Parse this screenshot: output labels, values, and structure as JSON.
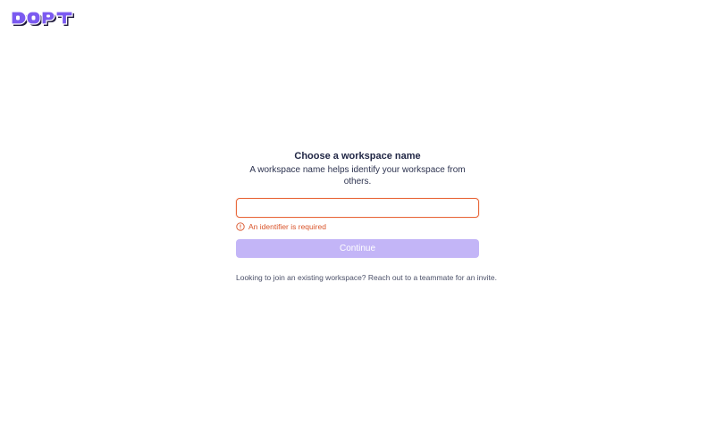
{
  "logo": {
    "text": "DOPT",
    "brand_color": "#7b5af0",
    "shadow_color": "#1f1a3d"
  },
  "form": {
    "title": "Choose a workspace name",
    "subtitle": "A workspace name helps identify your workspace from others.",
    "input_value": "",
    "input_placeholder": "",
    "error_message": "An identifier is required",
    "error_color": "#d9542a",
    "continue_label": "Continue",
    "continue_enabled": false,
    "footer_text": "Looking to join an existing workspace? Reach out to a teammate for an invite."
  }
}
